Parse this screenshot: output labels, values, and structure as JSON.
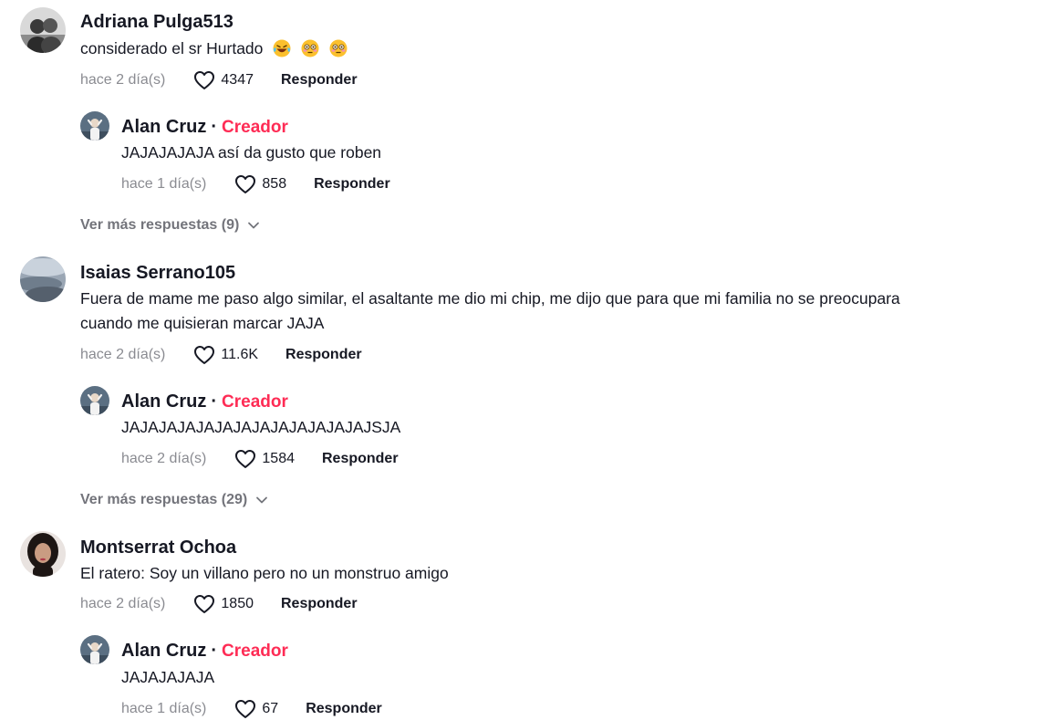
{
  "reply_label": "Responder",
  "comments": [
    {
      "author": "Adriana Pulga513",
      "text": "considerado el sr Hurtado",
      "emojis": [
        "laughing-face",
        "flushed-face",
        "flushed-face"
      ],
      "time": "hace 2 día(s)",
      "likes": "4347",
      "reply": {
        "author": "Alan Cruz",
        "separator": "·",
        "badge": "Creador",
        "text": "JAJAJAJAJA así da gusto que roben",
        "time": "hace 1 día(s)",
        "likes": "858"
      },
      "more_replies": "Ver más respuestas (9)"
    },
    {
      "author": "Isaias Serrano105",
      "text_line1": "Fuera de mame me paso algo similar, el asaltante me dio mi chip, me dijo que para que mi familia no se preocupara",
      "text_line2": "cuando me quisieran marcar JAJA",
      "time": "hace 2 día(s)",
      "likes": "11.6K",
      "reply": {
        "author": "Alan Cruz",
        "separator": "·",
        "badge": "Creador",
        "text": "JAJAJAJAJAJAJAJAJAJAJAJAJAJSJA",
        "time": "hace 2 día(s)",
        "likes": "1584"
      },
      "more_replies": "Ver más respuestas (29)"
    },
    {
      "author": "Montserrat Ochoa",
      "text": "El ratero: Soy un villano pero no un monstruo amigo",
      "time": "hace 2 día(s)",
      "likes": "1850",
      "reply": {
        "author": "Alan Cruz",
        "separator": "·",
        "badge": "Creador",
        "text": "JAJAJAJAJA",
        "time": "hace 1 día(s)",
        "likes": "67"
      }
    }
  ],
  "colors": {
    "text": "#161823",
    "muted": "#8a8b91",
    "creator_badge": "#fe2c55"
  }
}
